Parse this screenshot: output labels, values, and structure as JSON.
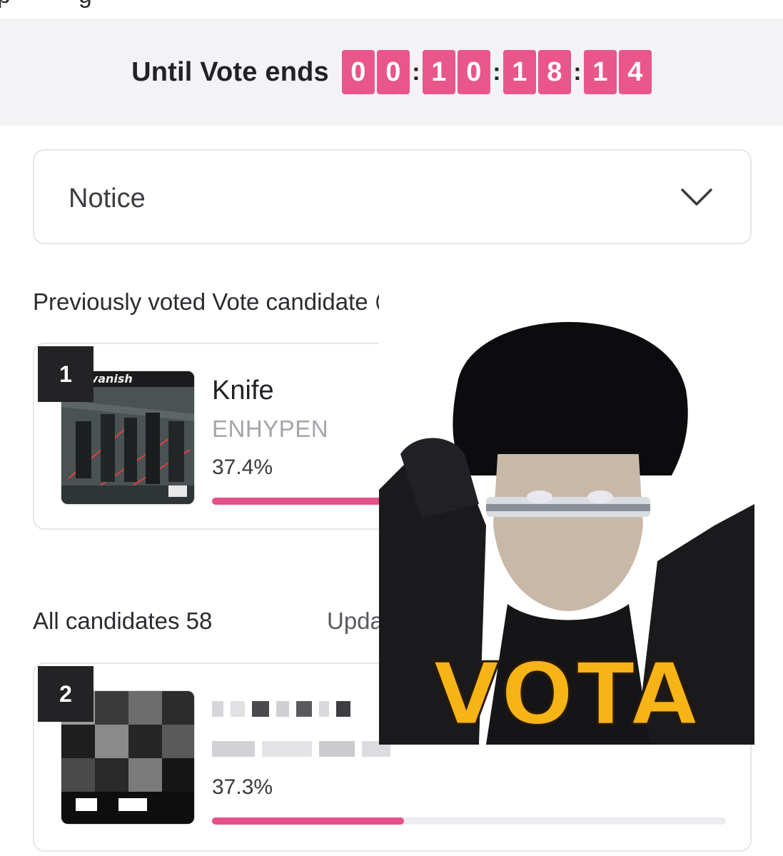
{
  "countdown": {
    "label": "Until Vote ends",
    "digits": [
      "0",
      "0",
      "1",
      "0",
      "1",
      "8",
      "1",
      "4"
    ],
    "separator": ":"
  },
  "notice": {
    "label": "Notice"
  },
  "previous": {
    "title": "Previously voted Vote candidate"
  },
  "candidates": [
    {
      "rank": "1",
      "title": "Knife",
      "artist": "ENHYPEN",
      "percent_label": "37.4%",
      "percent": 37.4,
      "album_text": "sin:vanish"
    },
    {
      "rank": "2",
      "percent_label": "37.3%",
      "percent": 37.3
    }
  ],
  "list_header": {
    "label": "All candidates 58",
    "updated_label": "Upda"
  },
  "overlay": {
    "text": "VOTA"
  },
  "colors": {
    "accent": "#e9568a",
    "overlay_text": "#f6b417"
  }
}
